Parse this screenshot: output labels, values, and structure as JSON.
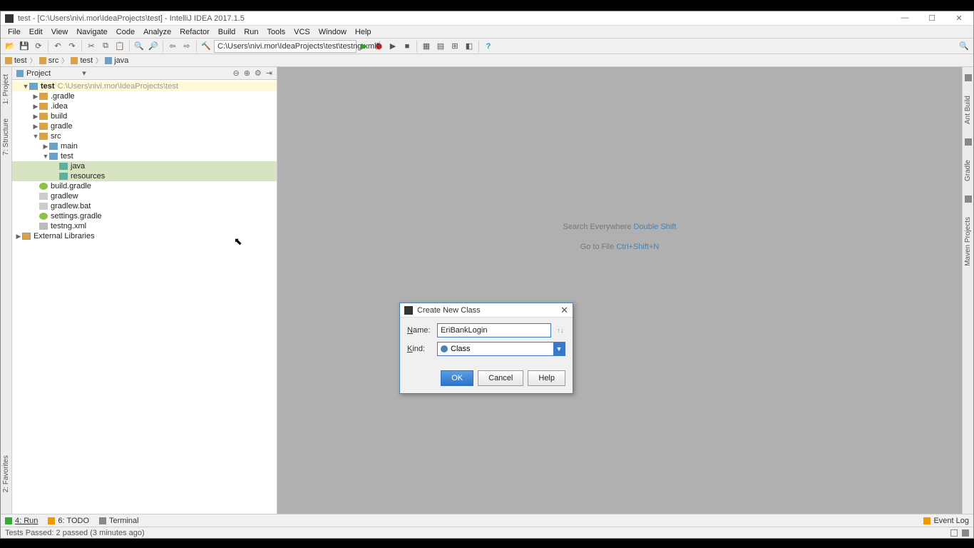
{
  "titlebar": {
    "text": "test - [C:\\Users\\nivi.mor\\IdeaProjects\\test] - IntelliJ IDEA 2017.1.5"
  },
  "menu": {
    "file": "File",
    "edit": "Edit",
    "view": "View",
    "navigate": "Navigate",
    "code": "Code",
    "analyze": "Analyze",
    "refactor": "Refactor",
    "build": "Build",
    "run": "Run",
    "tools": "Tools",
    "vcs": "VCS",
    "window": "Window",
    "help": "Help"
  },
  "runconfig": "C:\\Users\\nivi.mor\\IdeaProjects\\test\\testng.xml",
  "breadcrumb": {
    "p0": "test",
    "p1": "src",
    "p2": "test",
    "p3": "java"
  },
  "project": {
    "title": "Project",
    "root": "test",
    "root_path": "C:\\Users\\nivi.mor\\IdeaProjects\\test",
    "gradle_d": ".gradle",
    "idea_d": ".idea",
    "build_d": "build",
    "gradle_f": "gradle",
    "src": "src",
    "main": "main",
    "test": "test",
    "java": "java",
    "resources": "resources",
    "buildgradle": "build.gradle",
    "gradlew": "gradlew",
    "gradlewbat": "gradlew.bat",
    "settingsgradle": "settings.gradle",
    "testngxml": "testng.xml",
    "extlib": "External Libraries"
  },
  "hints": {
    "se_label": "Search Everywhere ",
    "se_key": "Double Shift",
    "gf_label": "Go to File ",
    "gf_key": "Ctrl+Shift+N"
  },
  "dialog": {
    "title": "Create New Class",
    "name_label": "Name:",
    "name_value": "EriBankLogin",
    "kind_label": "Kind:",
    "kind_value": "Class",
    "ok": "OK",
    "cancel": "Cancel",
    "help": "Help"
  },
  "bottombar": {
    "run": "4: Run",
    "todo": "6: TODO",
    "terminal": "Terminal",
    "eventlog": "Event Log"
  },
  "statusbar": {
    "text": "Tests Passed: 2 passed (3 minutes ago)"
  },
  "gutter": {
    "left1": "1: Project",
    "left2": "7: Structure",
    "left3": "2: Favorites",
    "right1": "Ant Build",
    "right2": "Gradle",
    "right3": "Maven Projects"
  }
}
